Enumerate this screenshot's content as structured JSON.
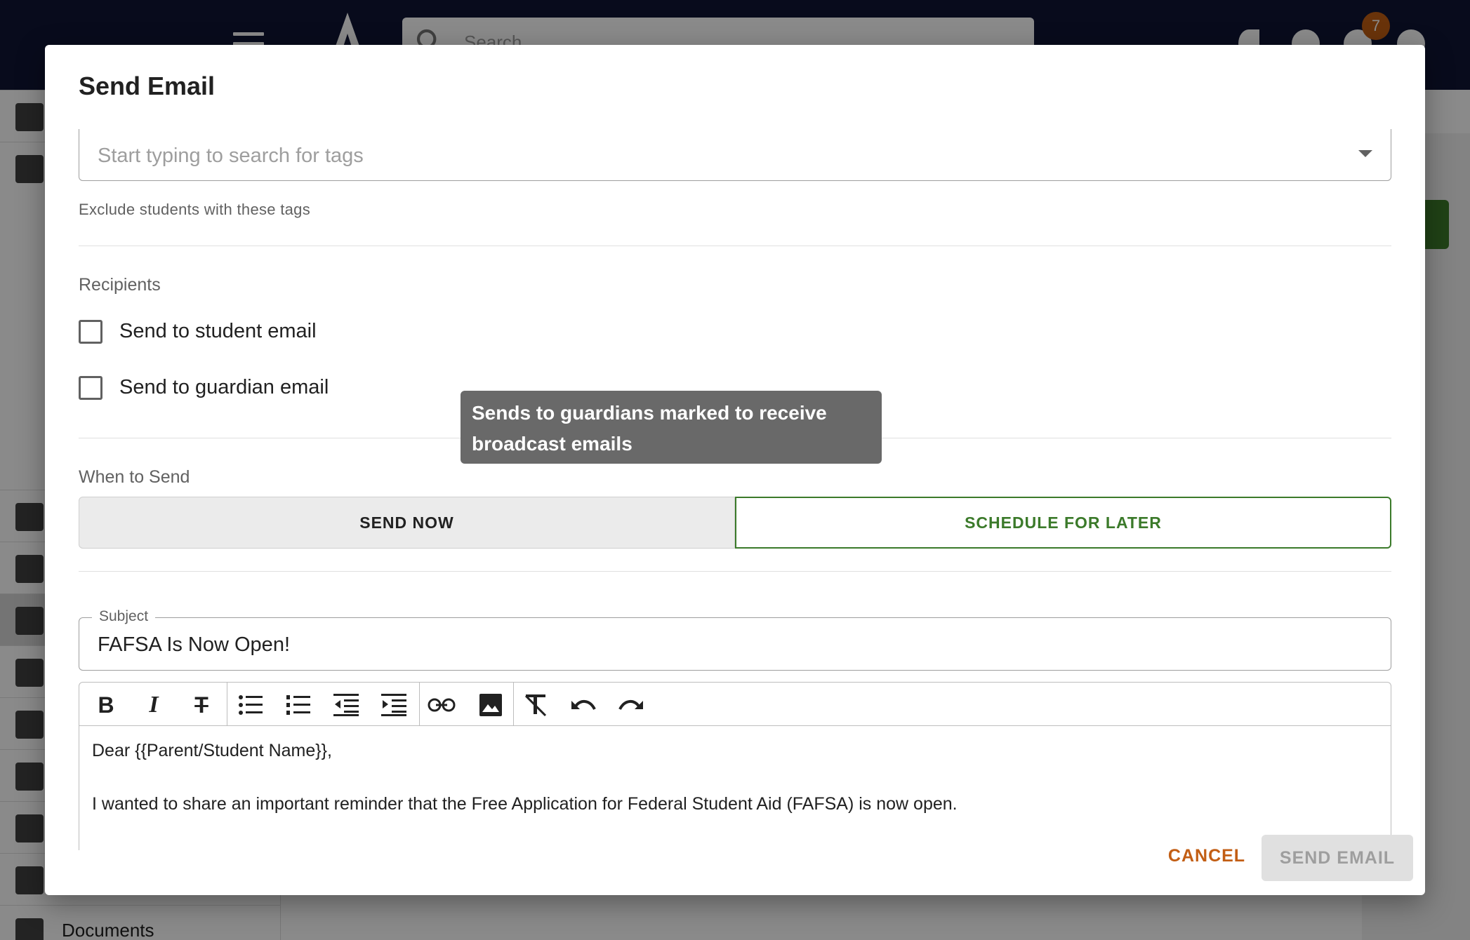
{
  "app_bar": {
    "search_placeholder": "Search",
    "notification_count": "7"
  },
  "sidebar": {
    "documents_label": "Documents"
  },
  "dialog": {
    "title": "Send Email",
    "exclude_tags": {
      "placeholder": "Start typing to search for tags",
      "hint": "Exclude students with these tags"
    },
    "recipients": {
      "label": "Recipients",
      "options": [
        {
          "label": "Send to student email",
          "checked": false
        },
        {
          "label": "Send to guardian email",
          "checked": false
        }
      ]
    },
    "when_to_send": {
      "label": "When to Send",
      "send_now": "SEND NOW",
      "schedule_later": "SCHEDULE FOR LATER",
      "selected": "SCHEDULE FOR LATER"
    },
    "tooltip": "Sends to guardians marked to receive broadcast emails",
    "subject": {
      "legend": "Subject",
      "value": "FAFSA Is Now Open!"
    },
    "editor": {
      "toolbar": [
        "bold-icon",
        "italic-icon",
        "strikethrough-icon",
        "bullet-list-icon",
        "numbered-list-icon",
        "outdent-icon",
        "indent-icon",
        "link-icon",
        "image-icon",
        "clear-format-icon",
        "undo-icon",
        "redo-icon"
      ],
      "lines": [
        "Dear {{Parent/Student Name}},",
        "I wanted to share an important reminder that the Free Application for Federal Student Aid (FAFSA) is now open."
      ]
    },
    "actions": {
      "cancel": "CANCEL",
      "send_email": "SEND EMAIL"
    }
  },
  "colors": {
    "app_bar": "#0f1634",
    "accent_green": "#3b7a2a",
    "accent_orange": "#c25e14"
  }
}
